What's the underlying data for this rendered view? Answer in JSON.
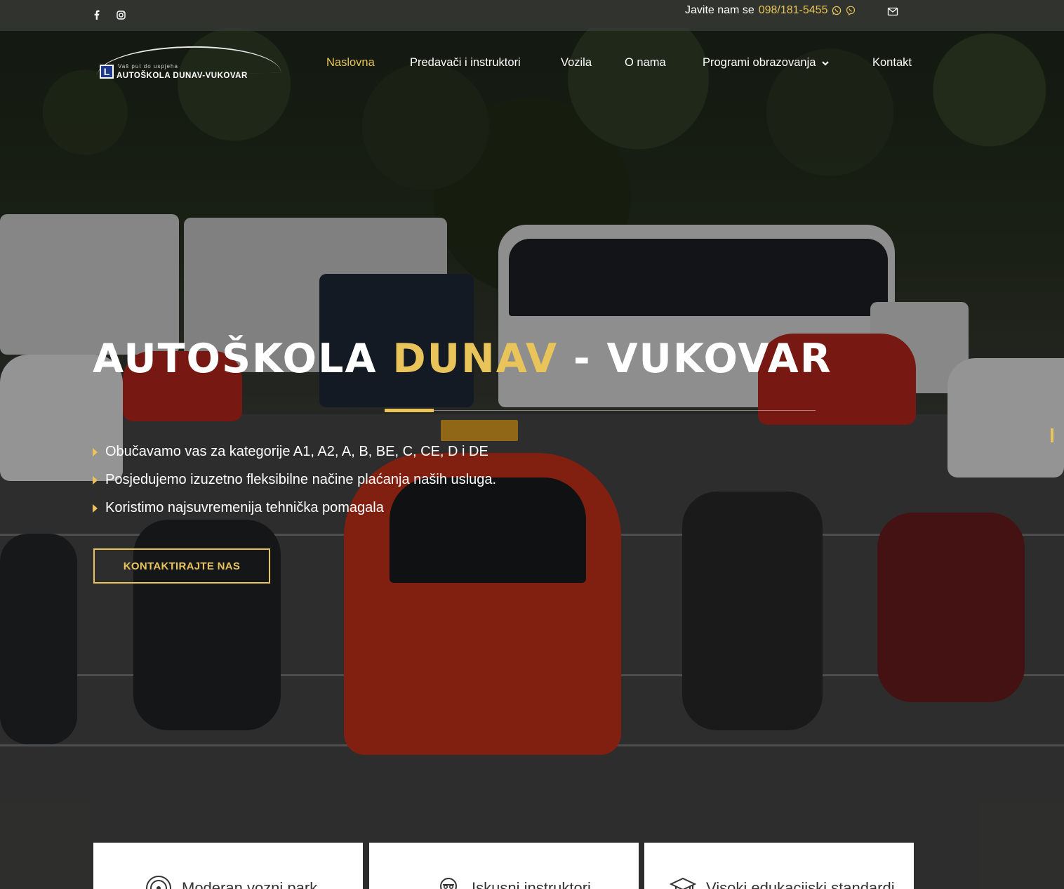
{
  "topbar": {
    "call_label": "Javite nam se",
    "phone": "098/181-5455",
    "social": [
      {
        "name": "facebook-icon",
        "glyph": "f"
      },
      {
        "name": "instagram-icon",
        "glyph": "◎"
      }
    ],
    "whatsapp_glyph": "✆",
    "viber_glyph": "✆"
  },
  "logo": {
    "tagline": "Vaš put do uspjeha",
    "name": "AUTOŠKOLA DUNAV-VUKOVAR",
    "badge": "L"
  },
  "nav": {
    "items": [
      {
        "label": "Naslovna",
        "active": true
      },
      {
        "label": "Predavači i instruktori",
        "active": false
      },
      {
        "label": "Vozila",
        "active": false
      },
      {
        "label": "O nama",
        "active": false
      },
      {
        "label": "Programi obrazovanja",
        "active": false,
        "has_dropdown": true
      },
      {
        "label": "Kontakt",
        "active": false
      }
    ],
    "dropdown_glyph": "⌄"
  },
  "hero": {
    "title_part1": "AUTOŠKOLA",
    "title_part2": "DUNAV",
    "title_part3": "- VUKOVAR",
    "bullets": [
      "Obučavamo vas za kategorije A1, A2, A, B, BE, C, CE, D i DE",
      "Posjedujemo izuzetno fleksibilne načine plaćanja naših usluga.",
      "Koristimo najsuvremenija tehnička pomagala"
    ],
    "cta_label": "KONTAKTIRAJTE NAS"
  },
  "features": [
    {
      "label": "Moderan vozni park",
      "icon": "steering-wheel-icon"
    },
    {
      "label": "Iskusni instruktori",
      "icon": "instructor-icon"
    },
    {
      "label": "Visoki edukacijski standardi",
      "icon": "graduation-cap-icon"
    }
  ],
  "colors": {
    "accent": "#e8c45a",
    "topbar_bg": "#3c3e3a",
    "text": "#ffffff",
    "card_bg": "#ffffff",
    "card_text": "#333333"
  }
}
